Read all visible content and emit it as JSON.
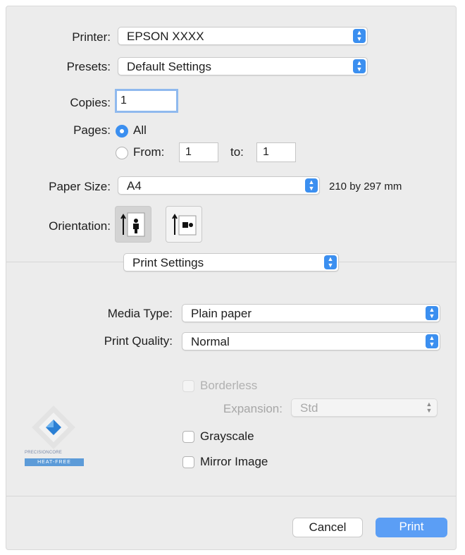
{
  "printer": {
    "label": "Printer:",
    "value": "EPSON XXXX"
  },
  "presets": {
    "label": "Presets:",
    "value": "Default Settings"
  },
  "copies": {
    "label": "Copies:",
    "value": "1"
  },
  "pages": {
    "label": "Pages:",
    "all_label": "All",
    "from_label": "From:",
    "from_value": "1",
    "to_label": "to:",
    "to_value": "1",
    "selected": "All"
  },
  "paper_size": {
    "label": "Paper Size:",
    "value": "A4",
    "dimensions": "210 by 297 mm"
  },
  "orientation": {
    "label": "Orientation:",
    "selected": "portrait"
  },
  "section": {
    "value": "Print Settings"
  },
  "media_type": {
    "label": "Media Type:",
    "value": "Plain paper"
  },
  "print_quality": {
    "label": "Print Quality:",
    "value": "Normal"
  },
  "borderless": {
    "label": "Borderless",
    "checked": false,
    "enabled": false
  },
  "expansion": {
    "label": "Expansion:",
    "value": "Std",
    "enabled": false
  },
  "grayscale": {
    "label": "Grayscale",
    "checked": false
  },
  "mirror_image": {
    "label": "Mirror Image",
    "checked": false
  },
  "logo": {
    "line1": "PRECISIONCORE",
    "line2": "HEAT-FREE"
  },
  "buttons": {
    "cancel": "Cancel",
    "print": "Print"
  },
  "colors": {
    "accent": "#3b8ff0",
    "panel": "#ececec"
  }
}
